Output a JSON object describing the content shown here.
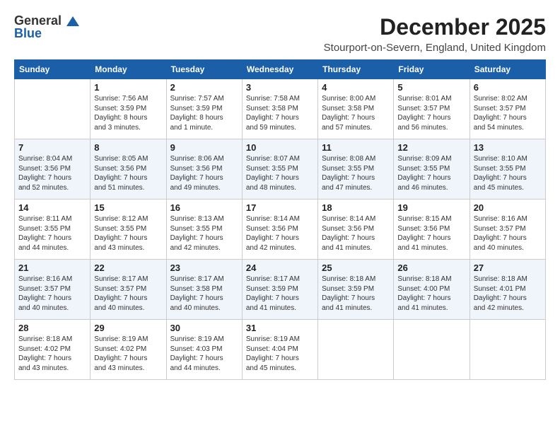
{
  "header": {
    "logo_general": "General",
    "logo_blue": "Blue",
    "month_title": "December 2025",
    "location": "Stourport-on-Severn, England, United Kingdom"
  },
  "days_of_week": [
    "Sunday",
    "Monday",
    "Tuesday",
    "Wednesday",
    "Thursday",
    "Friday",
    "Saturday"
  ],
  "weeks": [
    [
      {
        "day": "",
        "info": ""
      },
      {
        "day": "1",
        "info": "Sunrise: 7:56 AM\nSunset: 3:59 PM\nDaylight: 8 hours\nand 3 minutes."
      },
      {
        "day": "2",
        "info": "Sunrise: 7:57 AM\nSunset: 3:59 PM\nDaylight: 8 hours\nand 1 minute."
      },
      {
        "day": "3",
        "info": "Sunrise: 7:58 AM\nSunset: 3:58 PM\nDaylight: 7 hours\nand 59 minutes."
      },
      {
        "day": "4",
        "info": "Sunrise: 8:00 AM\nSunset: 3:58 PM\nDaylight: 7 hours\nand 57 minutes."
      },
      {
        "day": "5",
        "info": "Sunrise: 8:01 AM\nSunset: 3:57 PM\nDaylight: 7 hours\nand 56 minutes."
      },
      {
        "day": "6",
        "info": "Sunrise: 8:02 AM\nSunset: 3:57 PM\nDaylight: 7 hours\nand 54 minutes."
      }
    ],
    [
      {
        "day": "7",
        "info": "Sunrise: 8:04 AM\nSunset: 3:56 PM\nDaylight: 7 hours\nand 52 minutes."
      },
      {
        "day": "8",
        "info": "Sunrise: 8:05 AM\nSunset: 3:56 PM\nDaylight: 7 hours\nand 51 minutes."
      },
      {
        "day": "9",
        "info": "Sunrise: 8:06 AM\nSunset: 3:56 PM\nDaylight: 7 hours\nand 49 minutes."
      },
      {
        "day": "10",
        "info": "Sunrise: 8:07 AM\nSunset: 3:55 PM\nDaylight: 7 hours\nand 48 minutes."
      },
      {
        "day": "11",
        "info": "Sunrise: 8:08 AM\nSunset: 3:55 PM\nDaylight: 7 hours\nand 47 minutes."
      },
      {
        "day": "12",
        "info": "Sunrise: 8:09 AM\nSunset: 3:55 PM\nDaylight: 7 hours\nand 46 minutes."
      },
      {
        "day": "13",
        "info": "Sunrise: 8:10 AM\nSunset: 3:55 PM\nDaylight: 7 hours\nand 45 minutes."
      }
    ],
    [
      {
        "day": "14",
        "info": "Sunrise: 8:11 AM\nSunset: 3:55 PM\nDaylight: 7 hours\nand 44 minutes."
      },
      {
        "day": "15",
        "info": "Sunrise: 8:12 AM\nSunset: 3:55 PM\nDaylight: 7 hours\nand 43 minutes."
      },
      {
        "day": "16",
        "info": "Sunrise: 8:13 AM\nSunset: 3:55 PM\nDaylight: 7 hours\nand 42 minutes."
      },
      {
        "day": "17",
        "info": "Sunrise: 8:14 AM\nSunset: 3:56 PM\nDaylight: 7 hours\nand 42 minutes."
      },
      {
        "day": "18",
        "info": "Sunrise: 8:14 AM\nSunset: 3:56 PM\nDaylight: 7 hours\nand 41 minutes."
      },
      {
        "day": "19",
        "info": "Sunrise: 8:15 AM\nSunset: 3:56 PM\nDaylight: 7 hours\nand 41 minutes."
      },
      {
        "day": "20",
        "info": "Sunrise: 8:16 AM\nSunset: 3:57 PM\nDaylight: 7 hours\nand 40 minutes."
      }
    ],
    [
      {
        "day": "21",
        "info": "Sunrise: 8:16 AM\nSunset: 3:57 PM\nDaylight: 7 hours\nand 40 minutes."
      },
      {
        "day": "22",
        "info": "Sunrise: 8:17 AM\nSunset: 3:57 PM\nDaylight: 7 hours\nand 40 minutes."
      },
      {
        "day": "23",
        "info": "Sunrise: 8:17 AM\nSunset: 3:58 PM\nDaylight: 7 hours\nand 40 minutes."
      },
      {
        "day": "24",
        "info": "Sunrise: 8:17 AM\nSunset: 3:59 PM\nDaylight: 7 hours\nand 41 minutes."
      },
      {
        "day": "25",
        "info": "Sunrise: 8:18 AM\nSunset: 3:59 PM\nDaylight: 7 hours\nand 41 minutes."
      },
      {
        "day": "26",
        "info": "Sunrise: 8:18 AM\nSunset: 4:00 PM\nDaylight: 7 hours\nand 41 minutes."
      },
      {
        "day": "27",
        "info": "Sunrise: 8:18 AM\nSunset: 4:01 PM\nDaylight: 7 hours\nand 42 minutes."
      }
    ],
    [
      {
        "day": "28",
        "info": "Sunrise: 8:18 AM\nSunset: 4:02 PM\nDaylight: 7 hours\nand 43 minutes."
      },
      {
        "day": "29",
        "info": "Sunrise: 8:19 AM\nSunset: 4:02 PM\nDaylight: 7 hours\nand 43 minutes."
      },
      {
        "day": "30",
        "info": "Sunrise: 8:19 AM\nSunset: 4:03 PM\nDaylight: 7 hours\nand 44 minutes."
      },
      {
        "day": "31",
        "info": "Sunrise: 8:19 AM\nSunset: 4:04 PM\nDaylight: 7 hours\nand 45 minutes."
      },
      {
        "day": "",
        "info": ""
      },
      {
        "day": "",
        "info": ""
      },
      {
        "day": "",
        "info": ""
      }
    ]
  ]
}
